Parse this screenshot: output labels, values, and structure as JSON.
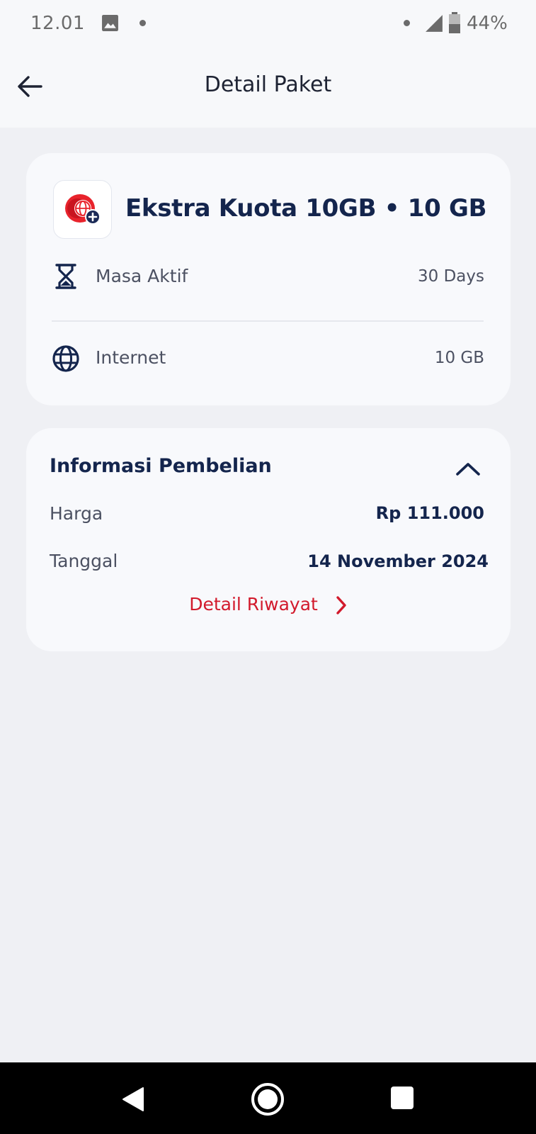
{
  "status_bar": {
    "time": "12.01",
    "battery_percent": "44%",
    "battery_level": 0.44,
    "icons": [
      "photo-icon",
      "notification-dot-icon",
      "signal-icon",
      "battery-icon"
    ]
  },
  "app_bar": {
    "title": "Detail Paket",
    "back_icon": "arrow-left-icon"
  },
  "package": {
    "logo_icon": "globe-plus-logo",
    "title": "Ekstra Kuota 10GB • 10 GB",
    "rows": [
      {
        "icon": "hourglass-icon",
        "label": "Masa Aktif",
        "value": "30 Days"
      },
      {
        "icon": "globe-icon",
        "label": "Internet",
        "value": "10 GB"
      }
    ]
  },
  "purchase": {
    "title": "Informasi Pembelian",
    "collapse_icon": "chevron-up-icon",
    "price_label": "Harga",
    "price_value": "Rp 111.000",
    "date_label": "Tanggal",
    "date_value": "14 November 2024",
    "history_link": "Detail Riwayat",
    "history_icon": "chevron-right-icon"
  },
  "colors": {
    "background": "#eff0f4",
    "card": "#f8f9fc",
    "navy": "#14254d",
    "accent_red": "#d21a2c"
  },
  "nav_bar": {
    "icons": [
      "nav-back-icon",
      "nav-home-icon",
      "nav-recents-icon"
    ]
  }
}
